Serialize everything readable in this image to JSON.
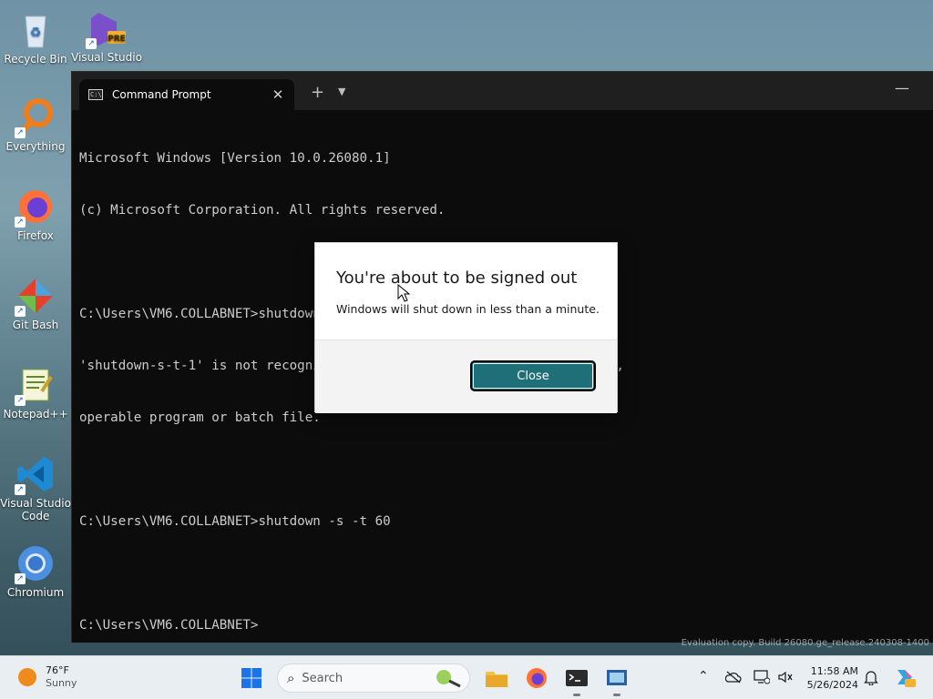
{
  "desktop": {
    "icons": [
      {
        "label": "Recycle Bin",
        "icon": "recycle-bin-icon"
      },
      {
        "label": "Visual Studio",
        "icon": "visual-studio-preview-icon",
        "badge": "PRE"
      },
      {
        "label": "Everything",
        "icon": "everything-search-icon"
      },
      {
        "label": "Firefox",
        "icon": "firefox-icon"
      },
      {
        "label": "Git Bash",
        "icon": "git-bash-icon"
      },
      {
        "label": "Notepad++",
        "icon": "notepad-plus-plus-icon"
      },
      {
        "label": "Visual Studio Code",
        "icon": "vscode-icon"
      },
      {
        "label": "Chromium",
        "icon": "chromium-icon"
      }
    ],
    "watermark": "Evaluation copy. Build 26080.ge_release.240308-1400"
  },
  "terminal": {
    "tab_title": "Command Prompt",
    "tab_icon": "C:\\",
    "new_tab": "+",
    "lines": [
      "Microsoft Windows [Version 10.0.26080.1]",
      "(c) Microsoft Corporation. All rights reserved.",
      "",
      "C:\\Users\\VM6.COLLABNET>shutdown-s-t-1",
      "'shutdown-s-t-1' is not recognized as an internal or external command,",
      "operable program or batch file.",
      "",
      "C:\\Users\\VM6.COLLABNET>shutdown -s -t 60",
      "",
      "C:\\Users\\VM6.COLLABNET>"
    ]
  },
  "dialog": {
    "title": "You're about to be signed out",
    "message": "Windows will shut down in less than a minute.",
    "close_label": "Close",
    "accent": "#1f6f78"
  },
  "taskbar": {
    "weather": {
      "temp": "76°F",
      "condition": "Sunny"
    },
    "search_placeholder": "Search",
    "time": "11:58 AM",
    "date": "5/26/2024",
    "apps": [
      "start-icon",
      "file-explorer-icon",
      "firefox-icon",
      "terminal-icon",
      "remote-desktop-icon"
    ]
  }
}
